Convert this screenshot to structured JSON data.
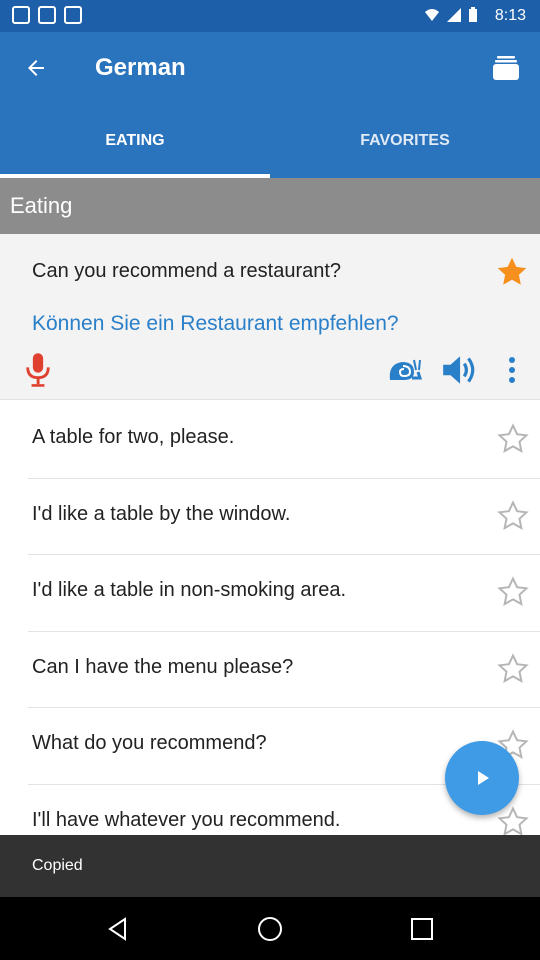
{
  "status_bar": {
    "time": "8:13"
  },
  "app_bar": {
    "title": "German"
  },
  "tabs": [
    {
      "label": "EATING",
      "active": true
    },
    {
      "label": "FAVORITES",
      "active": false
    }
  ],
  "section": {
    "title": "Eating"
  },
  "expanded_item": {
    "phrase": "Can you recommend a restaurant?",
    "translation": "Können Sie ein Restaurant empfehlen?",
    "favorite": true
  },
  "phrases": [
    {
      "text": "A table for two, please.",
      "favorite": false
    },
    {
      "text": "I'd like a table by the window.",
      "favorite": false
    },
    {
      "text": "I'd like a table in non-smoking area.",
      "favorite": false
    },
    {
      "text": "Can I have the menu please?",
      "favorite": false
    },
    {
      "text": "What do you recommend?",
      "favorite": false
    },
    {
      "text": "I'll have whatever you recommend.",
      "favorite": false
    }
  ],
  "snackbar": {
    "message": "Copied"
  },
  "colors": {
    "primary": "#2a73bd",
    "status_bar": "#1d5fa8",
    "accent_star": "#f5901e",
    "translation": "#2a7fc9",
    "mic": "#e0402f",
    "fab": "#3f9be6"
  },
  "icons": {
    "back": "arrow-left-icon",
    "stack": "card-stack-icon",
    "star_filled": "star-filled-icon",
    "star_outline": "star-outline-icon",
    "mic": "microphone-icon",
    "snail": "snail-icon",
    "speaker": "speaker-icon",
    "more": "more-vertical-icon",
    "play": "play-icon"
  }
}
